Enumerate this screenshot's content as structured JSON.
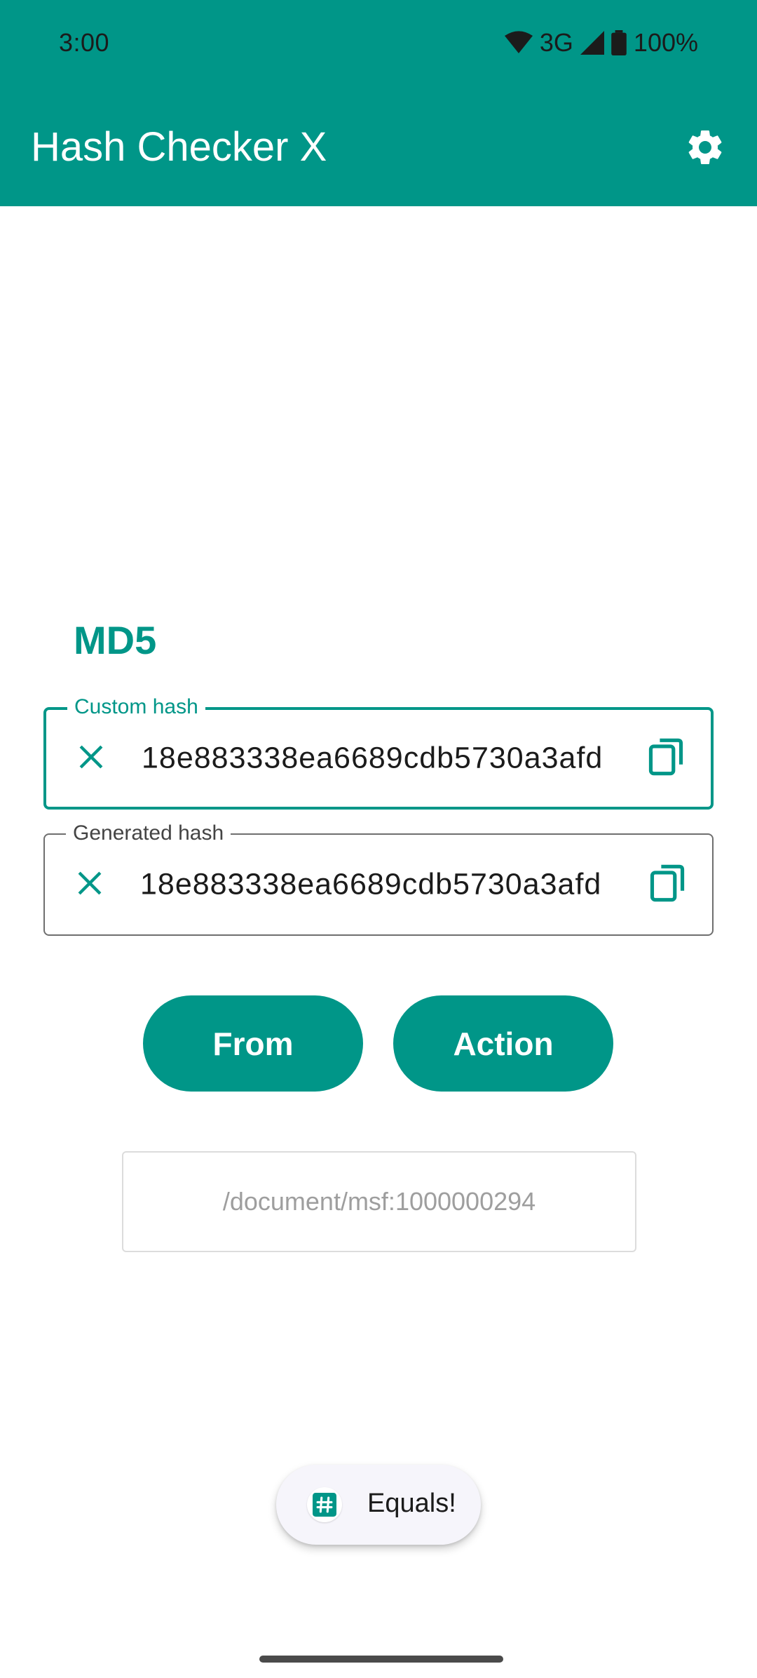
{
  "status_bar": {
    "time": "3:00",
    "network": "3G",
    "battery": "100%"
  },
  "toolbar": {
    "title": "Hash Checker X",
    "settings_icon": "gear-icon"
  },
  "algorithm": "MD5",
  "custom_hash": {
    "label": "Custom hash",
    "value": "18e883338ea6689cdb5730a3afd"
  },
  "generated_hash": {
    "label": "Generated hash",
    "value": "18e883338ea6689cdb5730a3afd"
  },
  "buttons": {
    "from_label": "From",
    "action_label": "Action"
  },
  "file_path": "/document/msf:1000000294",
  "toast": {
    "text": "Equals!",
    "icon": "hash-icon"
  },
  "colors": {
    "primary": "#009688",
    "toast_bg": "#f6f5fb"
  }
}
